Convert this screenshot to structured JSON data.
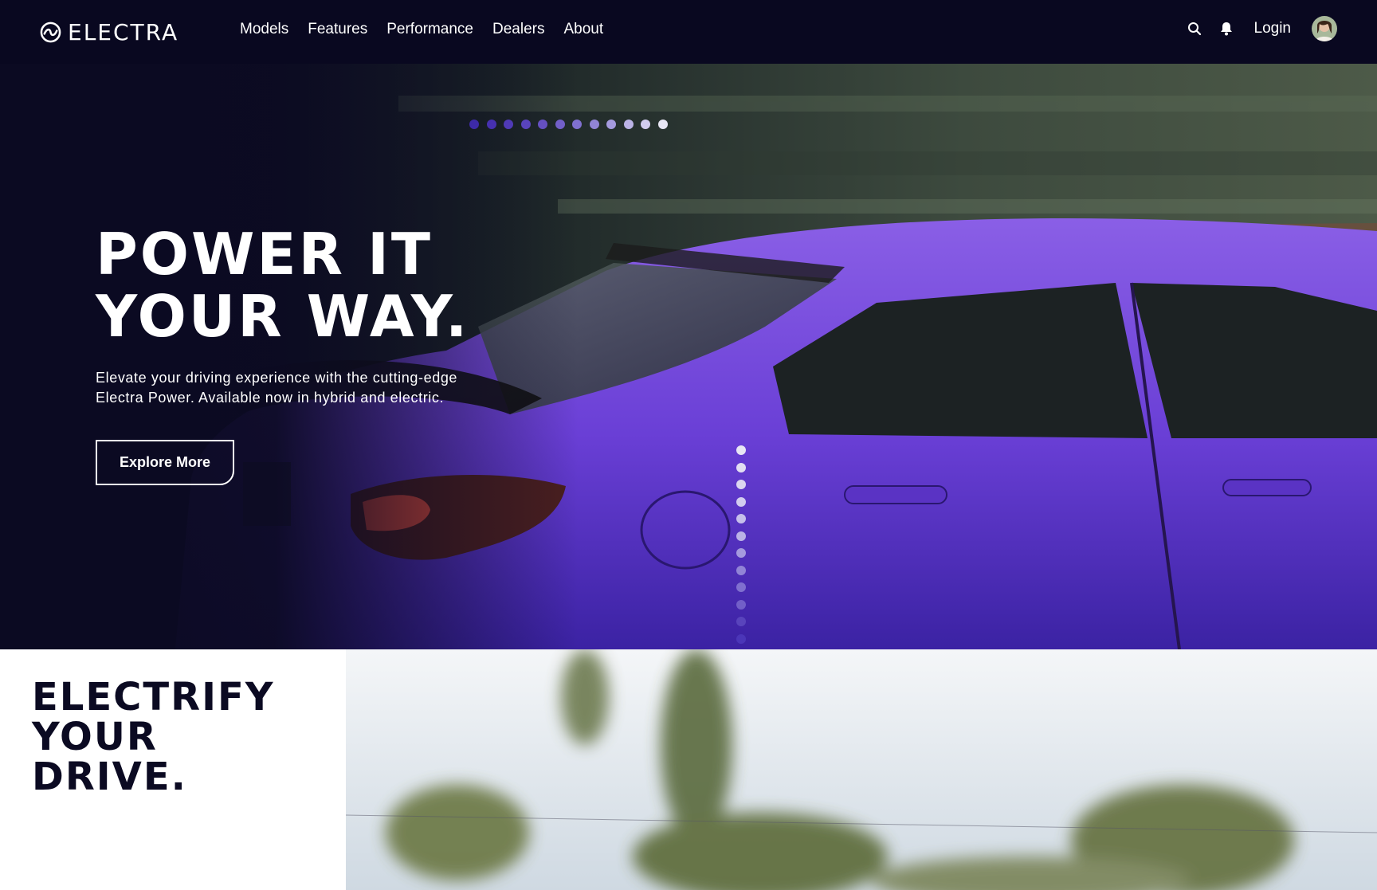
{
  "brand": {
    "name": "ELECTRA"
  },
  "nav": {
    "links": [
      "Models",
      "Features",
      "Performance",
      "Dealers",
      "About"
    ],
    "login_label": "Login"
  },
  "hero": {
    "title_line1": "POWER IT",
    "title_line2": "YOUR WAY.",
    "subtitle": "Elevate your driving experience with the cutting-edge Electra Power. Available now in hybrid and electric.",
    "cta_label": "Explore More",
    "carousel_dots": 12
  },
  "section": {
    "title_line1": "ELECTRIFY",
    "title_line2": "YOUR",
    "title_line3": "DRIVE."
  },
  "colors": {
    "nav_bg": "#090820",
    "car_purple": "#6a3fd6",
    "dot_dark": "#4b36b8",
    "dot_light": "#e8e6f4"
  },
  "icons": [
    "electra-logo-icon",
    "search-icon",
    "bell-icon"
  ]
}
